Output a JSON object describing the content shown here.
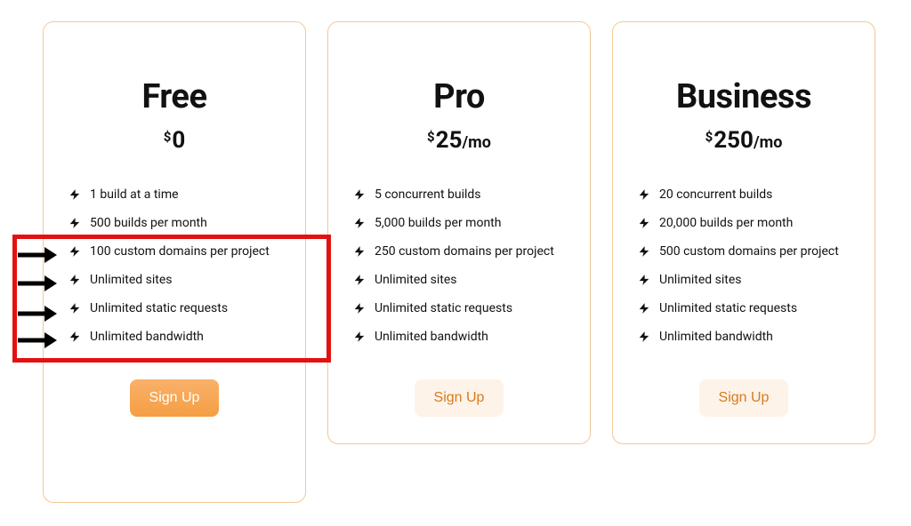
{
  "plans": [
    {
      "id": "free",
      "title": "Free",
      "currency": "$",
      "amount": "0",
      "per": "",
      "features": [
        "1 build at a time",
        "500 builds per month",
        "100 custom domains per project",
        "Unlimited sites",
        "Unlimited static requests",
        "Unlimited bandwidth"
      ],
      "cta": "Sign Up"
    },
    {
      "id": "pro",
      "title": "Pro",
      "currency": "$",
      "amount": "25",
      "per": "/mo",
      "features": [
        "5 concurrent builds",
        "5,000 builds per month",
        "250 custom domains per project",
        "Unlimited sites",
        "Unlimited static requests",
        "Unlimited bandwidth"
      ],
      "cta": "Sign Up"
    },
    {
      "id": "business",
      "title": "Business",
      "currency": "$",
      "amount": "250",
      "per": "/mo",
      "features": [
        "20 concurrent builds",
        "20,000 builds per month",
        "500 custom domains per project",
        "Unlimited sites",
        "Unlimited static requests",
        "Unlimited bandwidth"
      ],
      "cta": "Sign Up"
    }
  ],
  "annotation": {
    "highlighted_plan": "free",
    "highlighted_feature_indices": [
      2,
      3,
      4,
      5
    ]
  },
  "colors": {
    "accent": "#f59e43",
    "highlight_border": "#e31111"
  }
}
